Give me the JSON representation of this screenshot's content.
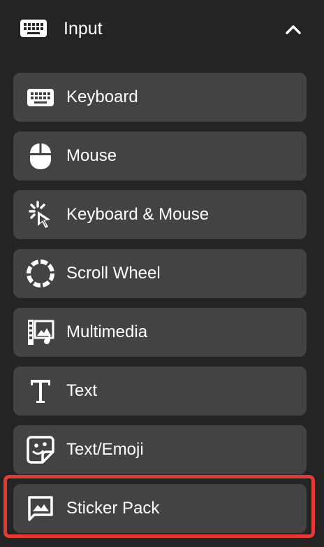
{
  "header": {
    "title": "Input",
    "icon": "keyboard-icon",
    "toggle_icon": "chevron-up-icon"
  },
  "items": [
    {
      "label": "Keyboard",
      "icon": "keyboard-icon"
    },
    {
      "label": "Mouse",
      "icon": "mouse-icon"
    },
    {
      "label": "Keyboard & Mouse",
      "icon": "click-cursor-icon"
    },
    {
      "label": "Scroll Wheel",
      "icon": "scroll-wheel-icon"
    },
    {
      "label": "Multimedia",
      "icon": "multimedia-icon"
    },
    {
      "label": "Text",
      "icon": "text-icon"
    },
    {
      "label": "Text/Emoji",
      "icon": "emoji-icon"
    },
    {
      "label": "Sticker Pack",
      "icon": "image-message-icon"
    }
  ],
  "colors": {
    "background": "#242424",
    "item_background": "#434343",
    "text": "#ffffff",
    "highlight": "#e53935"
  }
}
